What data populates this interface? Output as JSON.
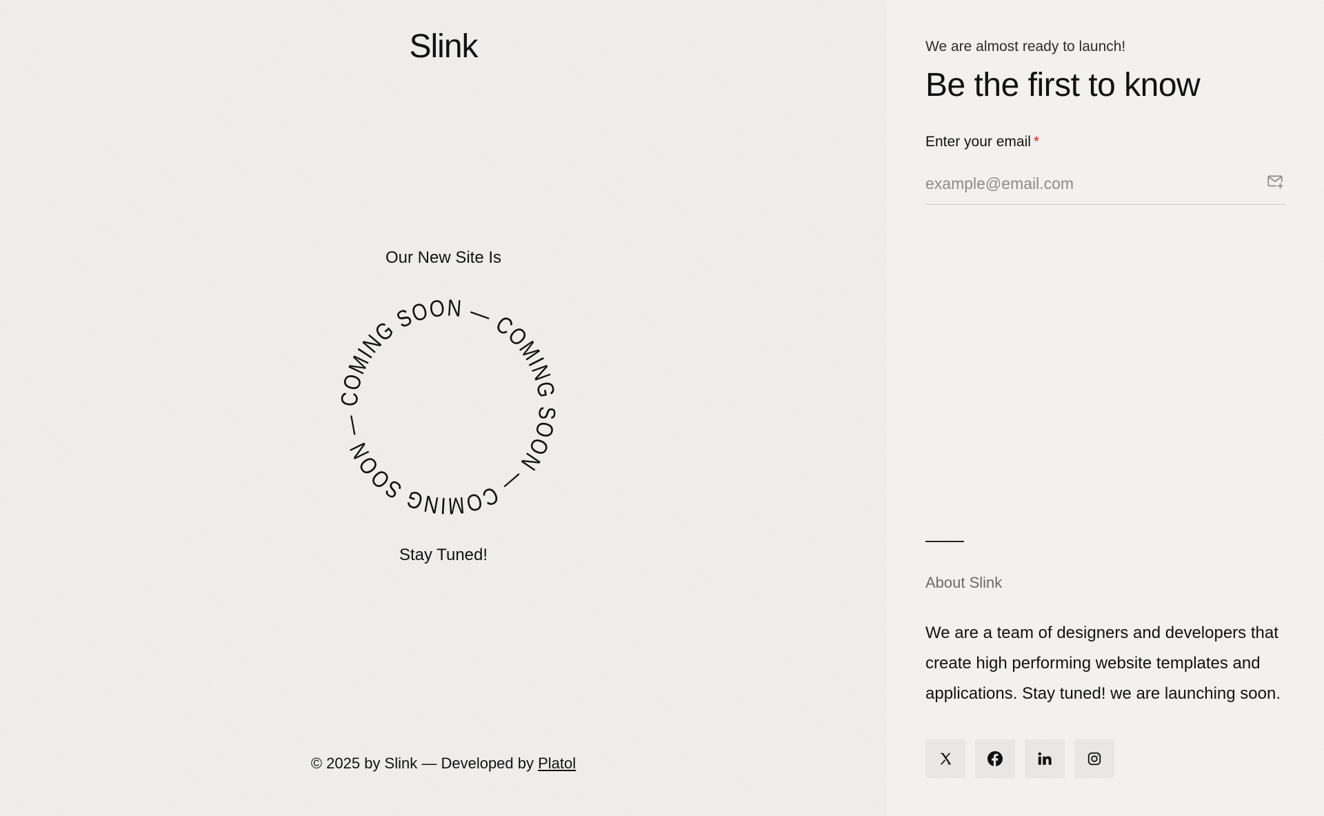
{
  "brand": {
    "name": "Slink"
  },
  "hero": {
    "intro": "Our New Site Is",
    "ring_text": "COMING SOON — COMING SOON — COMING SOON — ",
    "outro": "Stay Tuned!"
  },
  "footer": {
    "copyright": "© 2025 by Slink — Developed by ",
    "developer_link": "Platol"
  },
  "signup": {
    "kicker": "We are almost ready to launch!",
    "headline": "Be the first to know",
    "field_label": "Enter your email",
    "required_mark": "*",
    "placeholder": "example@email.com",
    "submit_icon": "mail-plus-icon"
  },
  "about": {
    "title": "About Slink",
    "body": "We are a team of designers and developers that create high performing website templates and applications. Stay tuned! we are launching soon."
  },
  "social": [
    {
      "icon": "x-twitter-icon"
    },
    {
      "icon": "facebook-icon"
    },
    {
      "icon": "linkedin-icon"
    },
    {
      "icon": "instagram-icon"
    }
  ],
  "colors": {
    "background": "#f0efee",
    "text": "#111111",
    "required": "#d2232a",
    "muted": "#6a6a6a"
  }
}
